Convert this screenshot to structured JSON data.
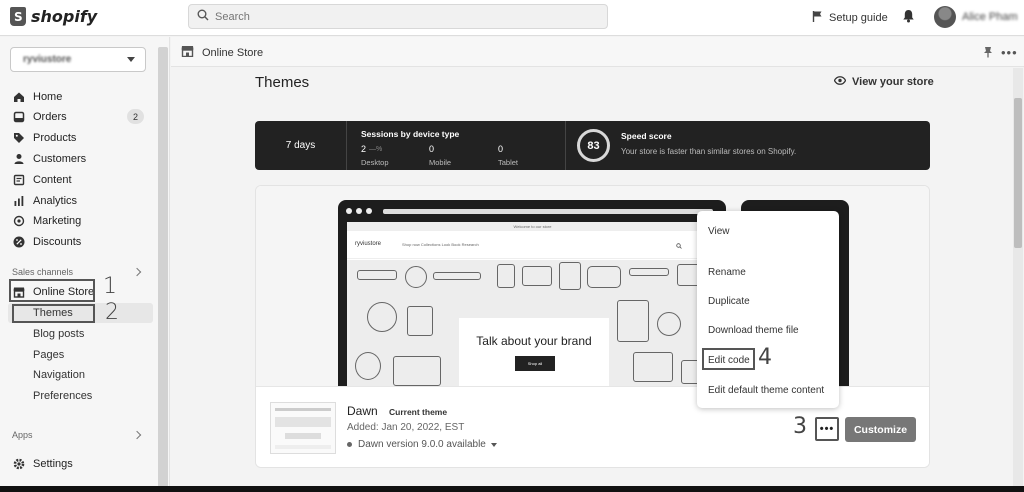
{
  "header": {
    "logo_text": "shopify",
    "search_placeholder": "Search",
    "setup_guide": "Setup guide",
    "user_name": "Alice Pham"
  },
  "sidebar": {
    "store_name": "ryviustore",
    "items": [
      {
        "label": "Home",
        "icon": "home-icon"
      },
      {
        "label": "Orders",
        "icon": "orders-icon",
        "badge": "2"
      },
      {
        "label": "Products",
        "icon": "products-icon"
      },
      {
        "label": "Customers",
        "icon": "customers-icon"
      },
      {
        "label": "Content",
        "icon": "content-icon"
      },
      {
        "label": "Analytics",
        "icon": "analytics-icon"
      },
      {
        "label": "Marketing",
        "icon": "marketing-icon"
      },
      {
        "label": "Discounts",
        "icon": "discounts-icon"
      }
    ],
    "sales_channels_label": "Sales channels",
    "online_store": "Online Store",
    "sub_items": [
      "Themes",
      "Blog posts",
      "Pages",
      "Navigation",
      "Preferences"
    ],
    "apps_label": "Apps",
    "settings": "Settings"
  },
  "annotations": {
    "n1": "1",
    "n2": "2",
    "n3": "3",
    "n4": "4"
  },
  "breadcrumb": {
    "title": "Online Store"
  },
  "page": {
    "title": "Themes",
    "view_store": "View your store"
  },
  "stats": {
    "period": "7 days",
    "sessions_title": "Sessions by device type",
    "desktop_value": "2",
    "desktop_change": "—%",
    "mobile_value": "0",
    "tablet_value": "0",
    "desktop_label": "Desktop",
    "mobile_label": "Mobile",
    "tablet_label": "Tablet",
    "speed_score": "83",
    "speed_title": "Speed score",
    "speed_desc": "Your store is faster than similar stores on Shopify."
  },
  "preview": {
    "announcement": "Welcome to our store",
    "brand": "ryviustore",
    "links": "Shop now   Collections   Look Book   Research",
    "banner_title": "Talk about your brand",
    "banner_button": "Shop all"
  },
  "theme": {
    "name": "Dawn",
    "current_label": "Current theme",
    "added": "Added: Jan 20, 2022, EST",
    "version": "Dawn version 9.0.0 available",
    "customize": "Customize",
    "more": "•••"
  },
  "menu": {
    "items": [
      "View",
      "Rename",
      "Duplicate",
      "Download theme file",
      "Edit code",
      "Edit default theme content"
    ]
  }
}
